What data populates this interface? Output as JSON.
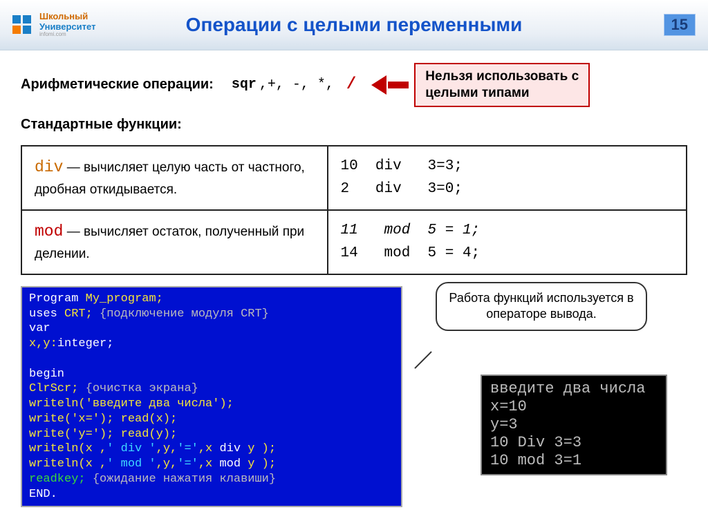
{
  "logo": {
    "line1": "Школьный",
    "line2": "Университет",
    "sub": "infomi.com"
  },
  "title": "Операции с целыми переменными",
  "page_number": "15",
  "arith": {
    "label": "Арифметические операции:",
    "ops_sqr": "sqr",
    "ops_rest": ",+, -,  *,",
    "ops_div": "/",
    "warn_l1": "Нельзя использовать с",
    "warn_l2": "целыми типами"
  },
  "std_label": "Стандартные функции:",
  "funcs": {
    "div": {
      "kw": "div",
      "desc": " — вычисляет целую часть от частного, дробная откидывается.",
      "ex": "10  div   3=3;\n2   div   3=0;"
    },
    "mod": {
      "kw": "mod",
      "desc": " — вычисляет остаток, полученный при делении.",
      "ex_l1": "11   mod  5 = 1;",
      "ex_l2": "14   mod  5 = 4;"
    }
  },
  "code": {
    "l0": "Program ",
    "l0b": "My_program;",
    "l1a": "uses ",
    "l1b": "CRT;   ",
    "l1c": "{подключение модуля CRT}",
    "l2": "var",
    "l3a": "    x,y:",
    "l3b": "integer;",
    "l4": "begin",
    "l5a": "ClrScr;   ",
    "l5b": "{очистка экрана}",
    "l6": "writeln('введите два числа');",
    "l7": "write('x=');  read(x);",
    "l8": "write('y=');  read(y);",
    "l9a": "writeln(x ,",
    "l9b": "' div '",
    "l9c": ",y,",
    "l9d": "'='",
    "l9e": ",x ",
    "l9f": "div",
    "l9g": " y );",
    "l10a": "writeln(x ,",
    "l10b": "' mod '",
    "l10c": ",y,",
    "l10d": "'='",
    "l10e": ",x ",
    "l10f": "mod",
    "l10g": " y );",
    "l11a": "readkey;  ",
    "l11b": "{ожидание нажатия клавиши}",
    "l12": "END."
  },
  "callout": "Работа функций используется в операторе вывода.",
  "output": "введите два числа\nx=10\ny=3\n10 Div 3=3\n10 mod 3=1"
}
